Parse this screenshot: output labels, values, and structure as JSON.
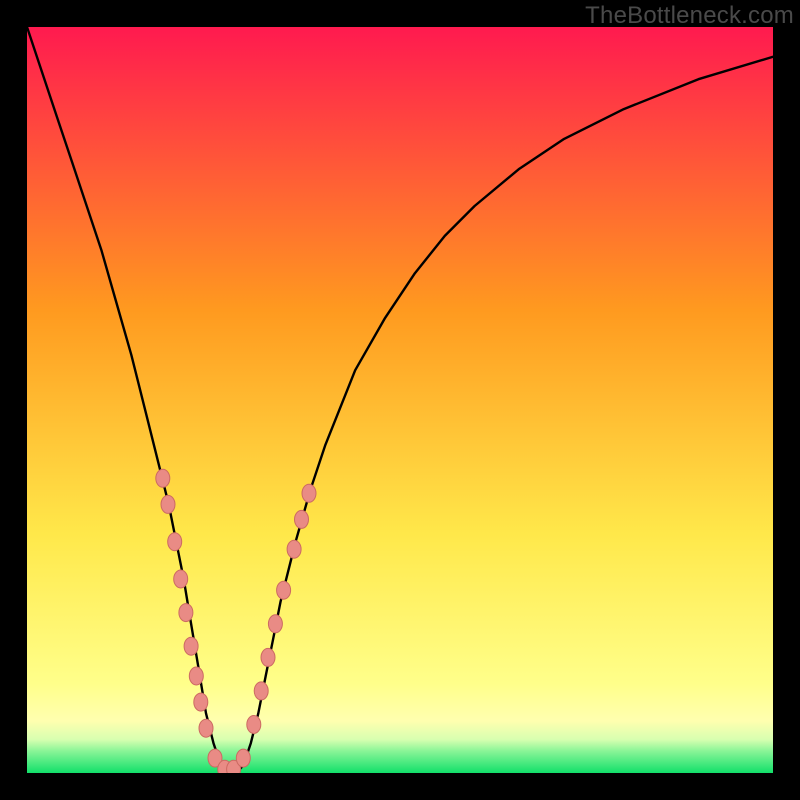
{
  "watermark": "TheBottleneck.com",
  "chart_data": {
    "type": "line",
    "title": "",
    "xlabel": "",
    "ylabel": "",
    "xlim": [
      0,
      100
    ],
    "ylim": [
      0,
      100
    ],
    "background_gradient": {
      "top": "#ff1a4f",
      "mid_upper": "#ff9a1f",
      "mid_lower": "#ffe84a",
      "band_light": "#ffffaf",
      "bottom": "#12e06a"
    },
    "series": [
      {
        "name": "bottleneck-curve",
        "color": "#000000",
        "x": [
          0,
          2,
          4,
          6,
          8,
          10,
          12,
          14,
          16,
          18,
          19,
          20,
          21,
          22,
          23,
          24,
          25,
          26,
          27,
          28,
          29,
          30,
          31,
          32,
          33,
          34,
          36,
          38,
          40,
          44,
          48,
          52,
          56,
          60,
          66,
          72,
          80,
          90,
          100
        ],
        "y": [
          100,
          94,
          88,
          82,
          76,
          70,
          63,
          56,
          48,
          40,
          36,
          31,
          26,
          20,
          14,
          8,
          4,
          1,
          0,
          0,
          1,
          4,
          8,
          13,
          18,
          23,
          31,
          38,
          44,
          54,
          61,
          67,
          72,
          76,
          81,
          85,
          89,
          93,
          96
        ]
      }
    ],
    "markers": {
      "name": "highlight-dots",
      "fill": "#e98b85",
      "stroke": "#cc6a62",
      "rx": 7,
      "ry": 9,
      "points_xy": [
        [
          18.2,
          39.5
        ],
        [
          18.9,
          36.0
        ],
        [
          19.8,
          31.0
        ],
        [
          20.6,
          26.0
        ],
        [
          21.3,
          21.5
        ],
        [
          22.0,
          17.0
        ],
        [
          22.7,
          13.0
        ],
        [
          23.3,
          9.5
        ],
        [
          24.0,
          6.0
        ],
        [
          25.2,
          2.0
        ],
        [
          26.5,
          0.5
        ],
        [
          27.7,
          0.5
        ],
        [
          29.0,
          2.0
        ],
        [
          30.4,
          6.5
        ],
        [
          31.4,
          11.0
        ],
        [
          32.3,
          15.5
        ],
        [
          33.3,
          20.0
        ],
        [
          34.4,
          24.5
        ],
        [
          35.8,
          30.0
        ],
        [
          36.8,
          34.0
        ],
        [
          37.8,
          37.5
        ]
      ]
    }
  }
}
